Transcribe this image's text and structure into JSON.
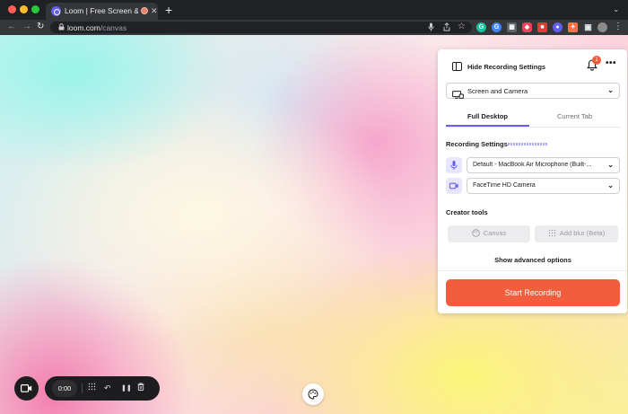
{
  "browser": {
    "tab_title": "Loom | Free Screen & Video",
    "tab_close": "✕",
    "new_tab": "+",
    "tab_menu": "⌄",
    "url_host": "loom.com",
    "url_path": "/canvas",
    "lock": "🔒",
    "nav": {
      "back": "←",
      "forward": "→",
      "reload": "↻"
    },
    "omnibox_icons": {
      "mic": "🎙",
      "share": "⇧",
      "star": "☆"
    },
    "extensions": [
      {
        "name": "grammarly-icon",
        "glyph": "G",
        "color": "#15c39a"
      },
      {
        "name": "google-icon",
        "glyph": "G",
        "color": "#4285f4"
      },
      {
        "name": "ext-grid-icon",
        "glyph": "▦",
        "color": "#5f6368"
      },
      {
        "name": "pocket-icon",
        "glyph": "◆",
        "color": "#ef4056"
      },
      {
        "name": "ext-red-icon",
        "glyph": "■",
        "color": "#e53935"
      },
      {
        "name": "ext-colors-icon",
        "glyph": "✦",
        "color": "#ff7043"
      },
      {
        "name": "extensions-puzzle-icon",
        "glyph": "✚",
        "color": "#5f6368"
      },
      {
        "name": "loom-ext-icon",
        "glyph": "●",
        "color": "#625df5"
      },
      {
        "name": "sidepanel-icon",
        "glyph": "▣",
        "color": "#5f6368"
      },
      {
        "name": "profile-avatar-icon",
        "glyph": "◉",
        "color": "#8a8a8a"
      }
    ],
    "menu": "⋮"
  },
  "panel": {
    "hide_label": "Hide Recording Settings",
    "notification_count": "1",
    "more": "•••",
    "source": "Screen and Camera",
    "tabs": {
      "active": "Full Desktop",
      "inactive": "Current Tab"
    },
    "recording_settings_title": "Recording Settings",
    "microphone": "Default - MacBook Air Microphone (Built-...",
    "camera": "FaceTime HD Camera",
    "creator_tools_title": "Creator tools",
    "canvas_label": "Canvas",
    "blur_label": "Add blur (Beta)",
    "advanced_label": "Show advanced options",
    "start_label": "Start Recording",
    "chevron": "⌄"
  },
  "controls": {
    "timer": "0:00",
    "undo": "↶",
    "pause": "❚❚",
    "delete": "🗑"
  },
  "colors": {
    "accent": "#625df5",
    "start": "#f25d3d"
  }
}
